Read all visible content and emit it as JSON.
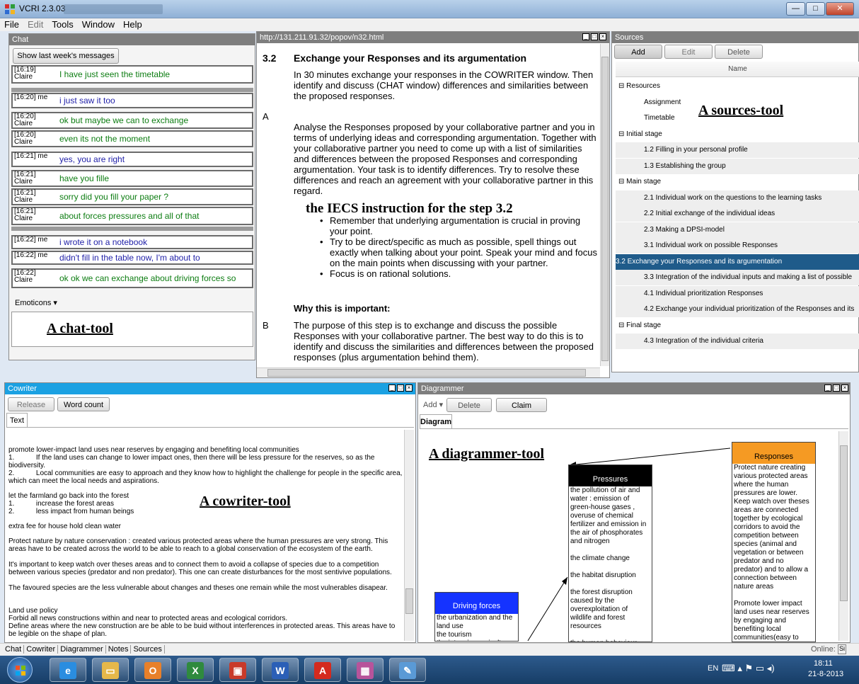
{
  "window": {
    "title": "VCRI 2.3.03",
    "controls": [
      "—",
      "□",
      "✕"
    ]
  },
  "menu": [
    "File",
    "Edit",
    "Tools",
    "Window",
    "Help"
  ],
  "chat": {
    "header": "Chat",
    "show_button": "Show last week's messages",
    "messages": [
      {
        "time": "[16:19]",
        "user": "Claire",
        "text": "I have just seen the timetable",
        "me": false
      },
      {
        "time": "[16:20] me",
        "user": "",
        "text": "i just saw it too",
        "me": true
      },
      {
        "time": "[16:20]",
        "user": "Claire",
        "text": "ok but maybe we can to exchange",
        "me": false
      },
      {
        "time": "[16:20]",
        "user": "Claire",
        "text": "even its not the moment",
        "me": false
      },
      {
        "time": "[16:21] me",
        "user": "",
        "text": "yes, you are right",
        "me": true
      },
      {
        "time": "[16:21]",
        "user": "Claire",
        "text": "have you fille",
        "me": false
      },
      {
        "time": "[16:21]",
        "user": "Claire",
        "text": "sorry did you fill your paper ?",
        "me": false
      },
      {
        "time": "[16:21]",
        "user": "Claire",
        "text": "about forces pressures and all of that",
        "me": false
      },
      {
        "time": "[16:22] me",
        "user": "",
        "text": "i wrote it on a notebook",
        "me": true
      },
      {
        "time": "[16:22] me",
        "user": "",
        "text": "didn't fill in the table now, I'm about to",
        "me": true
      },
      {
        "time": "[16:22]",
        "user": "Claire",
        "text": "ok ok we can exchange about driving forces so",
        "me": false
      }
    ],
    "emoticons": "Emoticons",
    "caption": "A chat-tool"
  },
  "browser": {
    "url": "http://131.211.91.32/popov/n32.html",
    "section_number": "3.2",
    "section_title": "Exchange your Responses and its argumentation",
    "intro": "In 30 minutes exchange your responses in the COWRITER window. Then identify and discuss (CHAT window) differences and similarities between the proposed responses.",
    "label_a": "A",
    "para_a": "Analyse the Responses proposed by your collaborative partner and you in terms of underlying ideas and corresponding argumentation. Together with your collaborative partner you need to come up with a list of similarities and differences between the proposed Responses and corresponding argumentation. Your task is to identify differences. Try to resolve these differences and reach an agreement with your collaborative partner in this regard.",
    "caption": "the IECS instruction for the step 3.2",
    "bullets": [
      "Remember that underlying argumentation is crucial in proving your point.",
      "Try to be direct/specific as much as possible, spell things out exactly when talking about your point. Speak your mind and focus on the main points when discussing with your partner.",
      "Focus is on rational solutions."
    ],
    "why_heading": "Why this is important:",
    "label_b": "B",
    "para_b": "The purpose of this step is to exchange and discuss the possible Responses with your collaborative partner. The best way to do this is to identify and discuss the similarities and differences between the proposed responses (plus argumentation behind them)."
  },
  "sources": {
    "header": "Sources",
    "buttons": {
      "add": "Add",
      "edit": "Edit",
      "delete": "Delete"
    },
    "column": "Name",
    "caption": "A sources-tool",
    "rows": [
      {
        "label": "Resources",
        "kind": "group"
      },
      {
        "label": "Assignment",
        "kind": "plain"
      },
      {
        "label": "Timetable",
        "kind": "plain"
      },
      {
        "label": "Initial stage",
        "kind": "group"
      },
      {
        "label": "1.2 Filling in your personal profile",
        "kind": "item"
      },
      {
        "label": "1.3 Establishing the group",
        "kind": "item"
      },
      {
        "label": "Main stage",
        "kind": "group"
      },
      {
        "label": "2.1 Individual work on the questions to the learning tasks",
        "kind": "item"
      },
      {
        "label": "2.2 Initial exchange of the individual ideas",
        "kind": "item"
      },
      {
        "label": "2.3 Making a DPSI-model",
        "kind": "item"
      },
      {
        "label": "3.1 Individual work on possible Responses",
        "kind": "item"
      },
      {
        "label": "3.2 Exchange your Responses and its argumentation",
        "kind": "sel"
      },
      {
        "label": "3.3 Integration of the individual inputs and making a list of possible",
        "kind": "item"
      },
      {
        "label": "4.1 Individual prioritization Responses",
        "kind": "item"
      },
      {
        "label": "4.2 Exchange your individual prioritization of the Responses and its",
        "kind": "item"
      },
      {
        "label": "Final stage",
        "kind": "group"
      },
      {
        "label": "4.3 Integration of the individual criteria",
        "kind": "item"
      }
    ]
  },
  "cowriter": {
    "header": "Cowriter",
    "release": "Release",
    "word_count": "Word count",
    "tab": "Text",
    "caption": "A cowriter-tool",
    "lines": [
      "promote lower-impact land uses near reserves by engaging and benefiting local communities",
      "1.           If the land uses can change to lower impact ones, then there will be less pressure for the reserves, so as the biodiversity.",
      "2.           Local communities are easy to approach and they know how to highlight the challenge for people in the specific area, which can meet the local needs and aspirations.",
      "",
      "let the farmland go back into the forest",
      "1.           increase the forest areas",
      "2.           less impact from human beings",
      "",
      "extra fee for house hold clean water",
      "",
      "Protect nature by nature conservation : created various protected areas where the human pressures are very strong. This areas have to be created across the world to be able to reach to a global conservation of the ecosystem of the earth.",
      "It's important to keep watch over theses areas and to connect them to avoid a collapse of species due to a competition between various species (predator and non predator). This one can create disturbances for the most sentivive populations.",
      "The favoured species are the less vulnerable about changes and theses one remain while the most vulnerables disapear.",
      "",
      "Land use policy",
      "Forbid all news constructions within and near to protected areas and ecological corridors.",
      "Define areas where the new construction are be able to be buid without interferences in protected areas. This areas have to be legible on the shape of plan."
    ]
  },
  "diagrammer": {
    "header": "Diagrammer",
    "add": "Add",
    "delete": "Delete",
    "claim": "Claim",
    "tab": "Diagram",
    "caption": "A diagrammer-tool",
    "boxes": {
      "driving": {
        "title": "Driving forces",
        "color": "#1533ff",
        "text": "the urbanization and the land use\nthe tourism\nthe intensive agriculture"
      },
      "pressures": {
        "title": "Pressures",
        "color": "#000000",
        "text": "the pollution of air and water : emission of green-house gases , overuse of chemical fertilizer and emission in the air of phosphorates and nitrogen\n\nthe climate change\n\nthe habitat disruption\n\nthe forest disruption caused by the overexploitation of wildlife and forest resources\n\nthe human behaviour"
      },
      "responses": {
        "title": "Responses",
        "color": "#f59a23",
        "text": "Protect nature creating various protected areas where the human pressures are lower. Keep watch over theses areas are connected together by ecological corridors to avoid the competition between species (animal and vegetation or between predator and no predator) and to allow a connection between nature areas\n\nPromote lower impact land uses near reserves by engaging and benefiting local communities(easy to approach and know how"
      }
    }
  },
  "statusbar": {
    "tabs": [
      "Chat",
      "Cowriter",
      "Diagrammer",
      "Notes",
      "Sources"
    ],
    "online": "Online:",
    "online_icon": "Si"
  },
  "taskbar": {
    "apps": [
      {
        "icon": "internet-explorer-icon",
        "glyph": "e",
        "color": "#2a8de0"
      },
      {
        "icon": "file-explorer-icon",
        "glyph": "▭",
        "color": "#e6b84a"
      },
      {
        "icon": "outlook-icon",
        "glyph": "O",
        "color": "#e8802a"
      },
      {
        "icon": "excel-icon",
        "glyph": "X",
        "color": "#2f8a3e"
      },
      {
        "icon": "presentation-icon",
        "glyph": "▣",
        "color": "#c83a2a"
      },
      {
        "icon": "word-icon",
        "glyph": "W",
        "color": "#2b5fb7"
      },
      {
        "icon": "acrobat-icon",
        "glyph": "A",
        "color": "#d42a1e"
      },
      {
        "icon": "vcri-icon",
        "glyph": "▦",
        "color": "#b8549b"
      },
      {
        "icon": "paint-icon",
        "glyph": "✎",
        "color": "#5a9ad6"
      }
    ],
    "language": "EN",
    "time": "18:11",
    "date": "21-8-2013"
  }
}
